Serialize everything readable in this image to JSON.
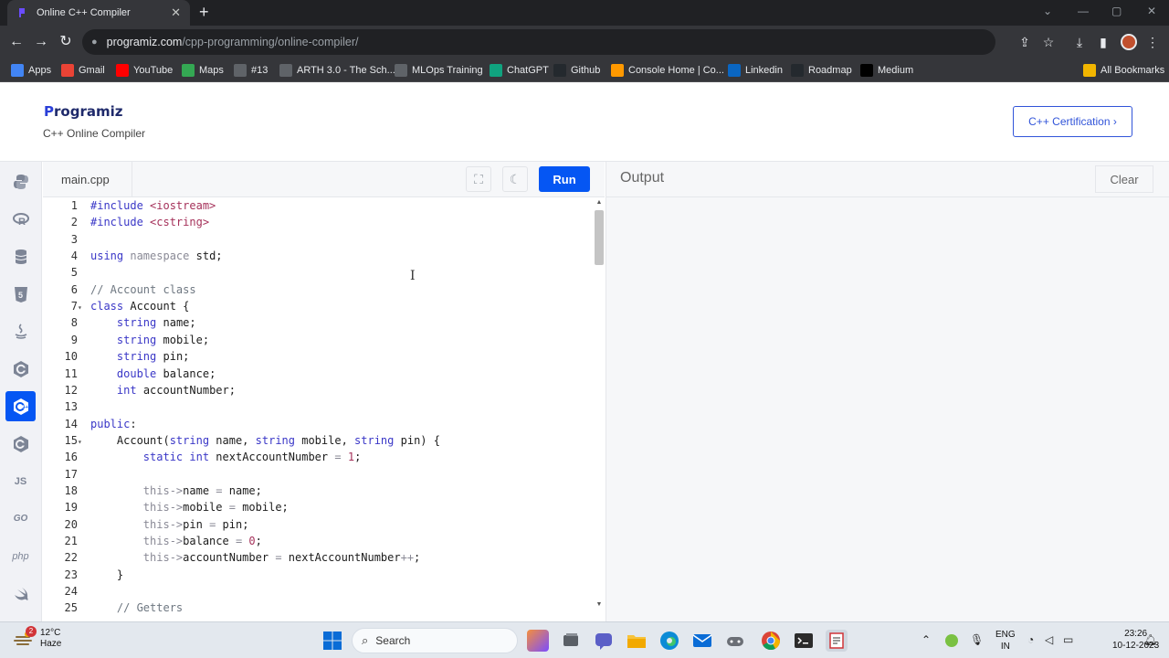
{
  "browser": {
    "tab_title": "Online C++ Compiler",
    "tab_close": "✕",
    "new_tab": "+",
    "url_domain": "programiz.com",
    "url_path": "/cpp-programming/online-compiler/",
    "bookmarks": [
      {
        "label": "Apps",
        "icon": "apps-grid-icon",
        "color": "#4285f4"
      },
      {
        "label": "Gmail",
        "icon": "gmail-icon",
        "color": "#ea4335"
      },
      {
        "label": "YouTube",
        "icon": "youtube-icon",
        "color": "#ff0000"
      },
      {
        "label": "Maps",
        "icon": "maps-icon",
        "color": "#34a853"
      },
      {
        "label": "#13",
        "icon": "page-icon",
        "color": "#5f6368"
      },
      {
        "label": "ARTH 3.0 - The Sch...",
        "icon": "page-icon",
        "color": "#5f6368"
      },
      {
        "label": "MLOps Training",
        "icon": "page-icon",
        "color": "#5f6368"
      },
      {
        "label": "ChatGPT",
        "icon": "chatgpt-icon",
        "color": "#10a37f"
      },
      {
        "label": "Github",
        "icon": "github-icon",
        "color": "#24292e"
      },
      {
        "label": "Console Home | Co...",
        "icon": "aws-icon",
        "color": "#ff9900"
      },
      {
        "label": "Linkedin",
        "icon": "linkedin-icon",
        "color": "#0a66c2"
      },
      {
        "label": "Roadmap",
        "icon": "github-icon",
        "color": "#24292e"
      },
      {
        "label": "Medium",
        "icon": "medium-icon",
        "color": "#000000"
      }
    ],
    "all_bookmarks": "All Bookmarks"
  },
  "header": {
    "logo_initial": "P",
    "logo_rest": "rogramiz",
    "subtitle": "C++ Online Compiler",
    "cert_button": "C++ Certification ›"
  },
  "sidebar": {
    "languages": [
      "python",
      "r",
      "sql",
      "html",
      "java",
      "c",
      "cpp",
      "csharp",
      "js",
      "go",
      "php",
      "swift"
    ],
    "active": "cpp",
    "labels": {
      "js": "JS",
      "go": "GO",
      "php": "php"
    }
  },
  "editor": {
    "filename": "main.cpp",
    "run_label": "Run",
    "lines": [
      {
        "n": "1",
        "fold": "",
        "html": "<span class=\"k\">#include</span> <span class=\"s\">&lt;iostream&gt;</span>"
      },
      {
        "n": "2",
        "fold": "",
        "html": "<span class=\"k\">#include</span> <span class=\"s\">&lt;cstring&gt;</span>"
      },
      {
        "n": "3",
        "fold": "",
        "html": ""
      },
      {
        "n": "4",
        "fold": "",
        "html": "<span class=\"k\">using</span> <span class=\"d\">namespace</span> std;"
      },
      {
        "n": "5",
        "fold": "",
        "html": ""
      },
      {
        "n": "6",
        "fold": "",
        "html": "<span class=\"c\">// Account class</span>"
      },
      {
        "n": "7",
        "fold": "▾",
        "html": "<span class=\"k\">class</span> Account {"
      },
      {
        "n": "8",
        "fold": "",
        "html": "    <span class=\"k\">string</span> name;"
      },
      {
        "n": "9",
        "fold": "",
        "html": "    <span class=\"k\">string</span> mobile;"
      },
      {
        "n": "10",
        "fold": "",
        "html": "    <span class=\"k\">string</span> pin;"
      },
      {
        "n": "11",
        "fold": "",
        "html": "    <span class=\"k\">double</span> balance;"
      },
      {
        "n": "12",
        "fold": "",
        "html": "    <span class=\"k\">int</span> accountNumber;"
      },
      {
        "n": "13",
        "fold": "",
        "html": ""
      },
      {
        "n": "14",
        "fold": "",
        "html": "<span class=\"k\">public</span>:"
      },
      {
        "n": "15",
        "fold": "▾",
        "html": "    Account(<span class=\"k\">string</span> name, <span class=\"k\">string</span> mobile, <span class=\"k\">string</span> pin) {"
      },
      {
        "n": "16",
        "fold": "",
        "html": "        <span class=\"k\">static</span> <span class=\"k\">int</span> nextAccountNumber <span class=\"d\">=</span> <span class=\"s\">1</span>;"
      },
      {
        "n": "17",
        "fold": "",
        "html": ""
      },
      {
        "n": "18",
        "fold": "",
        "html": "        <span class=\"d\">this-&gt;</span>name <span class=\"d\">=</span> name;"
      },
      {
        "n": "19",
        "fold": "",
        "html": "        <span class=\"d\">this-&gt;</span>mobile <span class=\"d\">=</span> mobile;"
      },
      {
        "n": "20",
        "fold": "",
        "html": "        <span class=\"d\">this-&gt;</span>pin <span class=\"d\">=</span> pin;"
      },
      {
        "n": "21",
        "fold": "",
        "html": "        <span class=\"d\">this-&gt;</span>balance <span class=\"d\">=</span> <span class=\"s\">0</span>;"
      },
      {
        "n": "22",
        "fold": "",
        "html": "        <span class=\"d\">this-&gt;</span>accountNumber <span class=\"d\">=</span> nextAccountNumber<span class=\"d\">++</span>;"
      },
      {
        "n": "23",
        "fold": "",
        "html": "    }"
      },
      {
        "n": "24",
        "fold": "",
        "html": ""
      },
      {
        "n": "25",
        "fold": "",
        "html": "    <span class=\"c\">// Getters</span>"
      }
    ]
  },
  "output": {
    "title": "Output",
    "clear_label": "Clear"
  },
  "taskbar": {
    "temperature": "12°C",
    "condition": "Haze",
    "weather_badge": "2",
    "search_label": "Search",
    "lang_top": "ENG",
    "lang_bottom": "IN",
    "time": "23:26",
    "date": "10-12-2023"
  }
}
